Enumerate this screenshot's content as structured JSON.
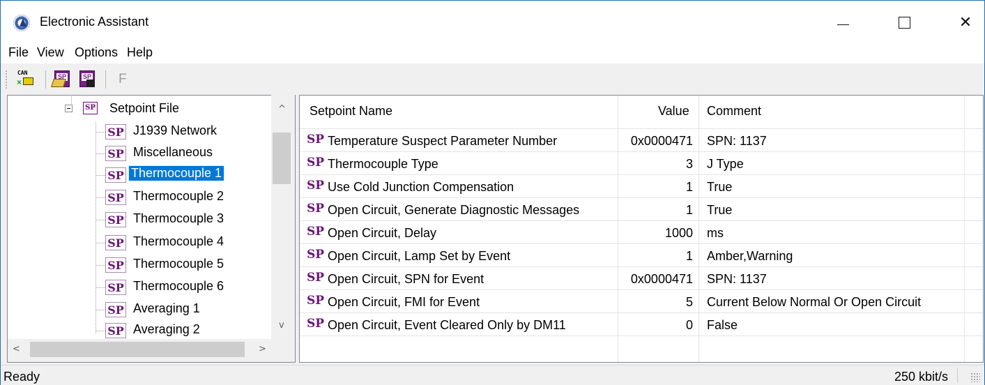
{
  "window": {
    "title": "Electronic Assistant",
    "icon": "electronic-assistant-logo-icon",
    "controls": [
      "minimize-icon",
      "maximize-icon",
      "close-icon"
    ]
  },
  "menu": [
    "File",
    "View",
    "Options",
    "Help"
  ],
  "toolbar": {
    "buttons": [
      {
        "name": "can-connect-button",
        "icon_text": "CAN"
      },
      {
        "name": "open-setpoint-file-button",
        "icon_text": "SP"
      },
      {
        "name": "save-setpoint-file-button",
        "icon_text": "SP"
      },
      {
        "name": "flash-button",
        "icon_text": "F"
      }
    ]
  },
  "tree": {
    "root": {
      "icon": "SP",
      "label": "Setpoint File"
    },
    "items": [
      {
        "icon": "SP",
        "label": "J1939 Network"
      },
      {
        "icon": "SP",
        "label": "Miscellaneous"
      },
      {
        "icon": "SP",
        "label": "Thermocouple 1",
        "selected": true
      },
      {
        "icon": "SP",
        "label": "Thermocouple 2"
      },
      {
        "icon": "SP",
        "label": "Thermocouple 3"
      },
      {
        "icon": "SP",
        "label": "Thermocouple 4"
      },
      {
        "icon": "SP",
        "label": "Thermocouple 5"
      },
      {
        "icon": "SP",
        "label": "Thermocouple 6"
      },
      {
        "icon": "SP",
        "label": "Averaging 1"
      },
      {
        "icon": "SP",
        "label": "Averaging 2"
      }
    ]
  },
  "list": {
    "columns": [
      "Setpoint Name",
      "Value",
      "Comment"
    ],
    "row_icon": "SP",
    "rows": [
      {
        "name": "Temperature Suspect Parameter Number",
        "value": "0x0000471",
        "comment": "SPN: 1137"
      },
      {
        "name": "Thermocouple Type",
        "value": "3",
        "comment": "J Type"
      },
      {
        "name": "Use Cold Junction Compensation",
        "value": "1",
        "comment": "True"
      },
      {
        "name": "Open Circuit, Generate Diagnostic Messages",
        "value": "1",
        "comment": "True"
      },
      {
        "name": "Open Circuit, Delay",
        "value": "1000",
        "comment": "ms"
      },
      {
        "name": "Open Circuit, Lamp Set by Event",
        "value": "1",
        "comment": "Amber,Warning"
      },
      {
        "name": "Open Circuit, SPN for Event",
        "value": "0x0000471",
        "comment": "SPN: 1137"
      },
      {
        "name": "Open Circuit, FMI for Event",
        "value": "5",
        "comment": "Current Below Normal Or Open Circuit"
      },
      {
        "name": "Open Circuit, Event Cleared Only by DM11",
        "value": "0",
        "comment": "False"
      }
    ]
  },
  "scroll": {
    "up": "^",
    "down": "v",
    "left": "<",
    "right": ">"
  },
  "status": {
    "text": "Ready",
    "baud_rate": "250 kbit/s"
  },
  "colors": {
    "selection": "#0078d7",
    "sp_purple": "#6b1577",
    "window_border": "#1a6fb3"
  }
}
